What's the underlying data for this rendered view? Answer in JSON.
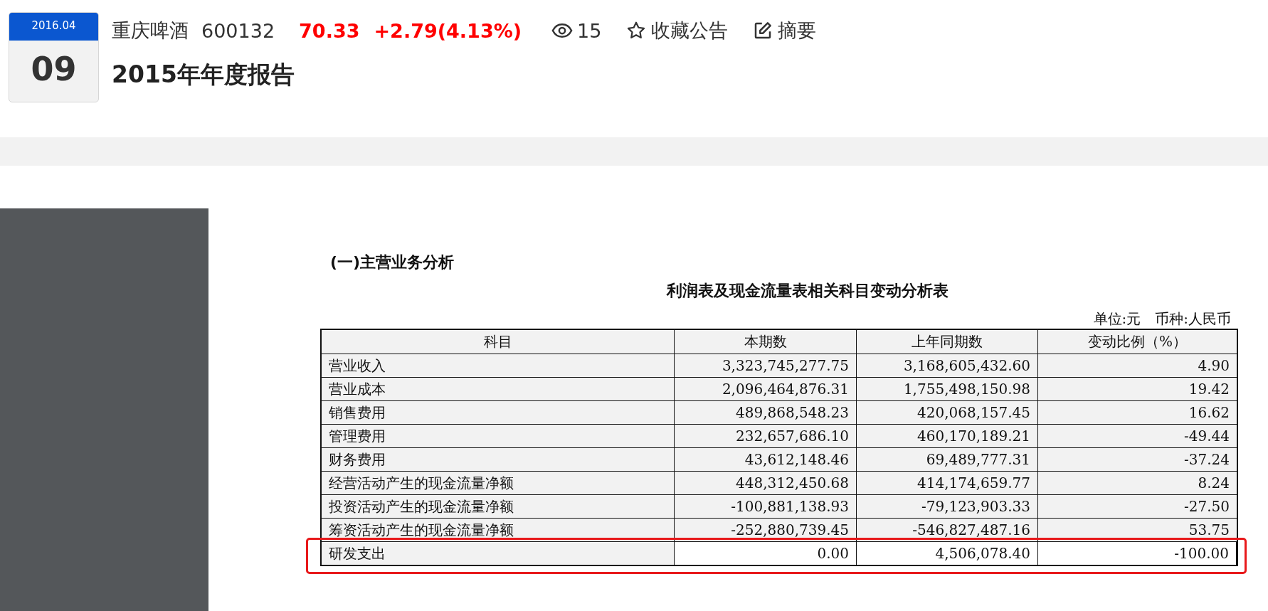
{
  "date_badge": {
    "month": "2016.04",
    "day": "09"
  },
  "stock": {
    "name": "重庆啤酒",
    "code": "600132",
    "price": "70.33",
    "change": "+2.79(4.13%)"
  },
  "views": "15",
  "actions": [
    {
      "kind": "favorite",
      "label": "收藏公告"
    },
    {
      "kind": "summary",
      "label": "摘要"
    }
  ],
  "title": "2015年年度报告",
  "document": {
    "section_heading": "(一)主营业务分析",
    "table_title": "利润表及现金流量表相关科目变动分析表",
    "unit_note": "单位:元　币种:人民币",
    "table": {
      "columns": [
        "科目",
        "本期数",
        "上年同期数",
        "变动比例（%）"
      ],
      "rows": [
        {
          "cells": [
            "营业收入",
            "3,323,745,277.75",
            "3,168,605,432.60",
            "4.90"
          ],
          "shaded": true,
          "highlighted": false
        },
        {
          "cells": [
            "营业成本",
            "2,096,464,876.31",
            "1,755,498,150.98",
            "19.42"
          ],
          "shaded": true,
          "highlighted": false
        },
        {
          "cells": [
            "销售费用",
            "489,868,548.23",
            "420,068,157.45",
            "16.62"
          ],
          "shaded": true,
          "highlighted": false
        },
        {
          "cells": [
            "管理费用",
            "232,657,686.10",
            "460,170,189.21",
            "-49.44"
          ],
          "shaded": true,
          "highlighted": false
        },
        {
          "cells": [
            "财务费用",
            "43,612,148.46",
            "69,489,777.31",
            "-37.24"
          ],
          "shaded": true,
          "highlighted": false
        },
        {
          "cells": [
            "经营活动产生的现金流量净额",
            "448,312,450.68",
            "414,174,659.77",
            "8.24"
          ],
          "shaded": true,
          "highlighted": false
        },
        {
          "cells": [
            "投资活动产生的现金流量净额",
            "-100,881,138.93",
            "-79,123,903.33",
            "-27.50"
          ],
          "shaded": true,
          "highlighted": false
        },
        {
          "cells": [
            "筹资活动产生的现金流量净额",
            "-252,880,739.45",
            "-546,827,487.16",
            "53.75"
          ],
          "shaded": true,
          "highlighted": false
        },
        {
          "cells": [
            "研发支出",
            "0.00",
            "4,506,078.40",
            "-100.00"
          ],
          "shaded": false,
          "highlighted": true
        }
      ]
    }
  }
}
